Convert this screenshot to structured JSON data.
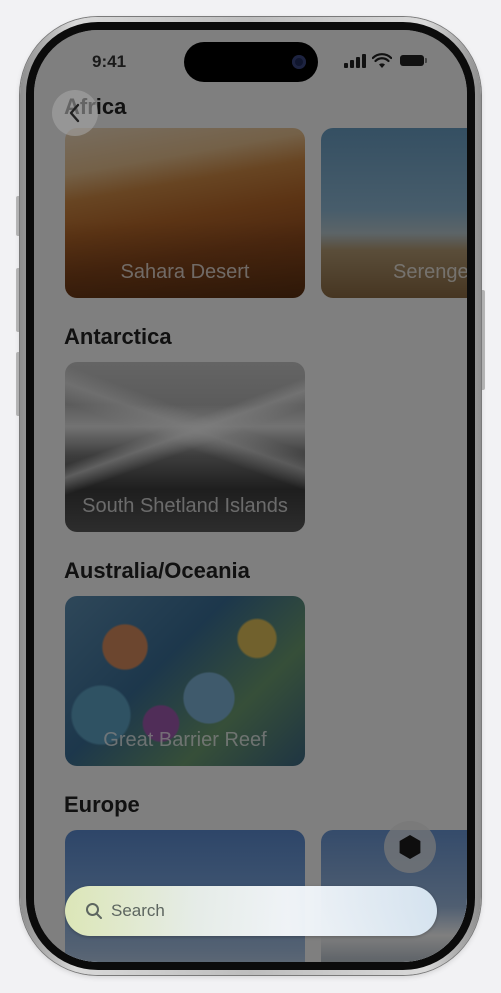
{
  "status_bar": {
    "time": "9:41"
  },
  "navigation": {
    "back_icon": "chevron-left-icon"
  },
  "sections": [
    {
      "heading": "Africa",
      "cards": [
        "Sahara Desert",
        "Serengeti"
      ]
    },
    {
      "heading": "Antarctica",
      "cards": [
        "South Shetland Islands"
      ]
    },
    {
      "heading": "Australia/Oceania",
      "cards": [
        "Great Barrier Reef"
      ]
    },
    {
      "heading": "Europe",
      "cards": [
        "",
        ""
      ]
    }
  ],
  "floating_button": {
    "icon": "hexagon-icon"
  },
  "search": {
    "placeholder": "Search",
    "icon": "magnifying-glass-icon"
  },
  "colors": {
    "overlay": "#000000",
    "accent": "#e2ecba"
  }
}
